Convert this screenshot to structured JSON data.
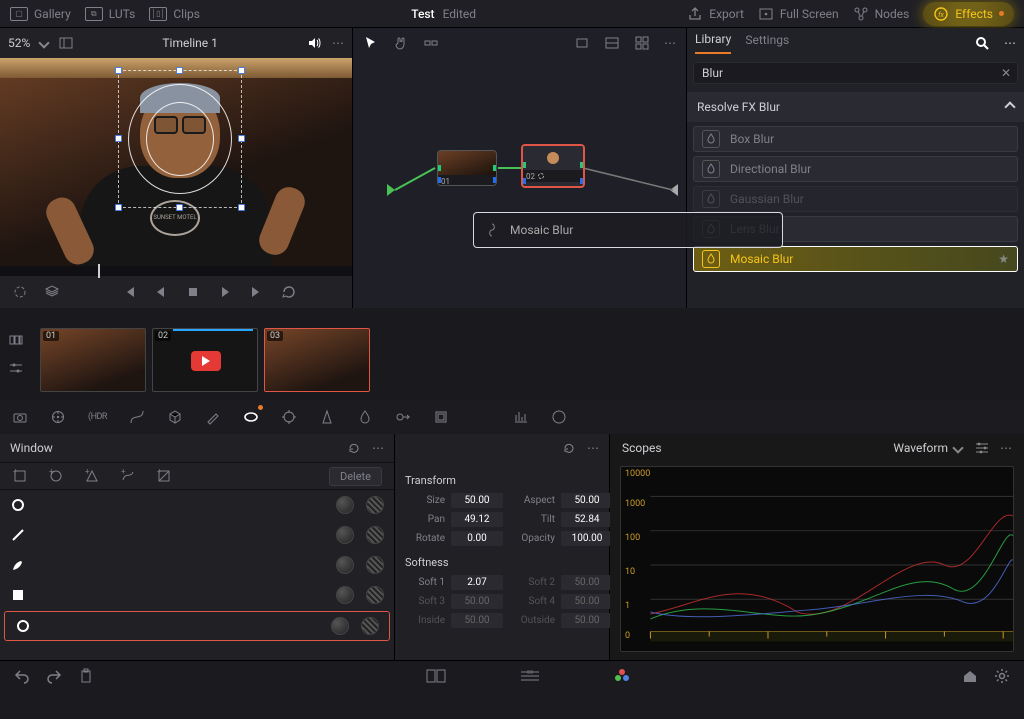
{
  "top": {
    "project_title": "Test",
    "project_status": "Edited",
    "menu": {
      "gallery": "Gallery",
      "luts": "LUTs",
      "clips": "Clips",
      "export": "Export",
      "fullscreen": "Full Screen",
      "nodes": "Nodes",
      "effects": "Effects"
    }
  },
  "viewer": {
    "zoom": "52%",
    "timeline_name": "Timeline 1",
    "tshirt_text": "SUNSET MOTEL"
  },
  "transport": {
    "icons": [
      "loop",
      "layers",
      "first",
      "prev",
      "stop",
      "play",
      "next",
      "last",
      "reloop"
    ]
  },
  "nodes": {
    "node1_label": "01",
    "node2_label": "02",
    "drag_effect_name": "Mosaic Blur"
  },
  "library": {
    "tabs": {
      "library": "Library",
      "settings": "Settings"
    },
    "search": {
      "value": "Blur"
    },
    "category": "Resolve FX Blur",
    "effects": [
      {
        "name": "Box Blur",
        "selected": false,
        "faded": false
      },
      {
        "name": "Directional Blur",
        "selected": false,
        "faded": false
      },
      {
        "name": "Gaussian Blur",
        "selected": false,
        "faded": true
      },
      {
        "name": "Lens Blur",
        "selected": false,
        "faded": false
      },
      {
        "name": "Mosaic Blur",
        "selected": true,
        "faded": false
      }
    ]
  },
  "clips": {
    "items": [
      {
        "num": "01",
        "barColor": "#2aa6ff",
        "selected": false,
        "content": "video"
      },
      {
        "num": "02",
        "barColor": "#2aa6ff",
        "selected": false,
        "content": "youtube",
        "fx": "fx"
      },
      {
        "num": "03",
        "barColor": "#e87b2a",
        "selected": true,
        "content": "video"
      }
    ]
  },
  "palette_icons": [
    "camera",
    "wheel",
    "hdr",
    "curves",
    "warp",
    "eyedropper",
    "crop",
    "tracker",
    "blur-triangle",
    "dust",
    "key",
    "sizing",
    "stereo",
    "scopes-toggle"
  ],
  "window": {
    "title": "Window",
    "delete": "Delete",
    "rows": [
      {
        "shape": "circle",
        "active": false
      },
      {
        "shape": "line",
        "active": false
      },
      {
        "shape": "pen",
        "active": false
      },
      {
        "shape": "square",
        "active": false
      },
      {
        "shape": "circle",
        "active": true
      }
    ]
  },
  "transform": {
    "title": "Transform",
    "softness_title": "Softness",
    "fields": {
      "size": {
        "label": "Size",
        "value": "50.00"
      },
      "aspect": {
        "label": "Aspect",
        "value": "50.00"
      },
      "pan": {
        "label": "Pan",
        "value": "49.12"
      },
      "tilt": {
        "label": "Tilt",
        "value": "52.84"
      },
      "rotate": {
        "label": "Rotate",
        "value": "0.00"
      },
      "opacity": {
        "label": "Opacity",
        "value": "100.00"
      },
      "soft1": {
        "label": "Soft 1",
        "value": "2.07"
      },
      "soft2": {
        "label": "Soft 2",
        "value": "50.00"
      },
      "soft3": {
        "label": "Soft 3",
        "value": "50.00"
      },
      "soft4": {
        "label": "Soft 4",
        "value": "50.00"
      },
      "inside": {
        "label": "Inside",
        "value": "50.00"
      },
      "outside": {
        "label": "Outside",
        "value": "50.00"
      }
    }
  },
  "scopes": {
    "title": "Scopes",
    "mode": "Waveform",
    "scale": [
      "10000",
      "1000",
      "100",
      "10",
      "1",
      "0"
    ]
  }
}
